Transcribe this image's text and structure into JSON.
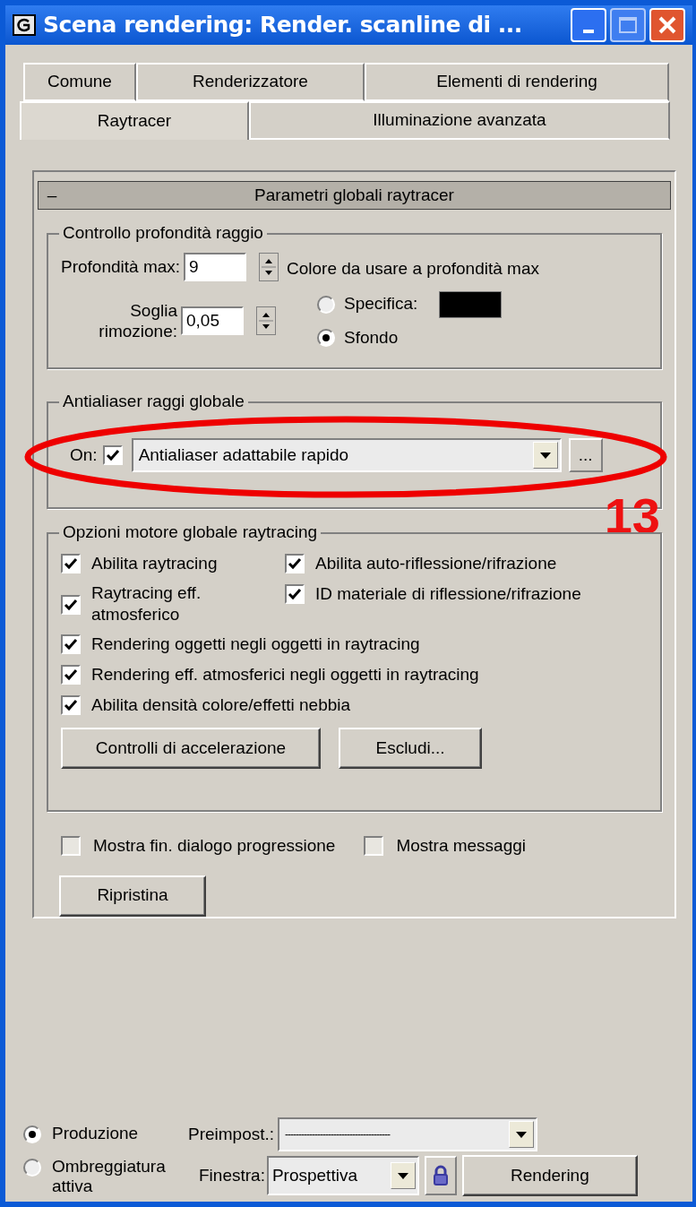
{
  "window": {
    "title": "Scena rendering: Render. scanline di ..."
  },
  "tabs": [
    [
      {
        "label": "Comune",
        "selected": false
      },
      {
        "label": "Renderizzatore",
        "selected": false
      },
      {
        "label": "Elementi di rendering",
        "selected": false
      }
    ],
    [
      {
        "label": "Raytracer",
        "selected": true
      },
      {
        "label": "Illuminazione avanzata",
        "selected": false
      }
    ]
  ],
  "rollout": {
    "toggle": "–",
    "title": "Parametri globali raytracer"
  },
  "depth_group": {
    "label": "Controllo profondità raggio",
    "max_depth": {
      "label": "Profondità max:",
      "value": "9"
    },
    "threshold": {
      "label": "Soglia rimozione:",
      "value": "0,05"
    },
    "color_label": "Colore da usare a profondità max",
    "options": [
      {
        "label": "Specifica:",
        "selected": false,
        "swatch": true
      },
      {
        "label": "Sfondo",
        "selected": true,
        "swatch": false
      }
    ]
  },
  "antialias_group": {
    "label": "Antialiaser raggi globale",
    "on_label": "On:",
    "checked": true,
    "value": "Antialiaser adattabile rapido",
    "more": "..."
  },
  "engine_group": {
    "label": "Opzioni motore globale raytracing",
    "options": [
      {
        "label": "Abilita raytracing",
        "checked": true
      },
      {
        "label": "Abilita auto-riflessione/rifrazione",
        "checked": true
      },
      {
        "label": "Raytracing eff. atmosferico",
        "checked": true
      },
      {
        "label": "ID materiale di riflessione/rifrazione",
        "checked": true
      },
      {
        "label": "Rendering oggetti negli oggetti in raytracing",
        "checked": true
      },
      {
        "label": "Rendering eff. atmosferici negli oggetti in raytracing",
        "checked": true
      },
      {
        "label": "Abilita densità colore/effetti nebbia",
        "checked": true
      }
    ],
    "buttons": [
      "Controlli di accelerazione",
      "Escludi..."
    ]
  },
  "extra_options": [
    {
      "label": "Mostra fin. dialogo progressione",
      "checked": false
    },
    {
      "label": "Mostra messaggi",
      "checked": false
    }
  ],
  "reset_button": "Ripristina",
  "annotation": {
    "label": "13"
  },
  "footer": {
    "modes": [
      {
        "label": "Produzione",
        "selected": true
      },
      {
        "label": "Ombreggiatura attiva",
        "selected": false
      }
    ],
    "preset": {
      "label": "Preimpost.:",
      "value": "---------------------------------------"
    },
    "viewport": {
      "label": "Finestra:",
      "value": "Prospettiva"
    },
    "render_button": "Rendering"
  }
}
